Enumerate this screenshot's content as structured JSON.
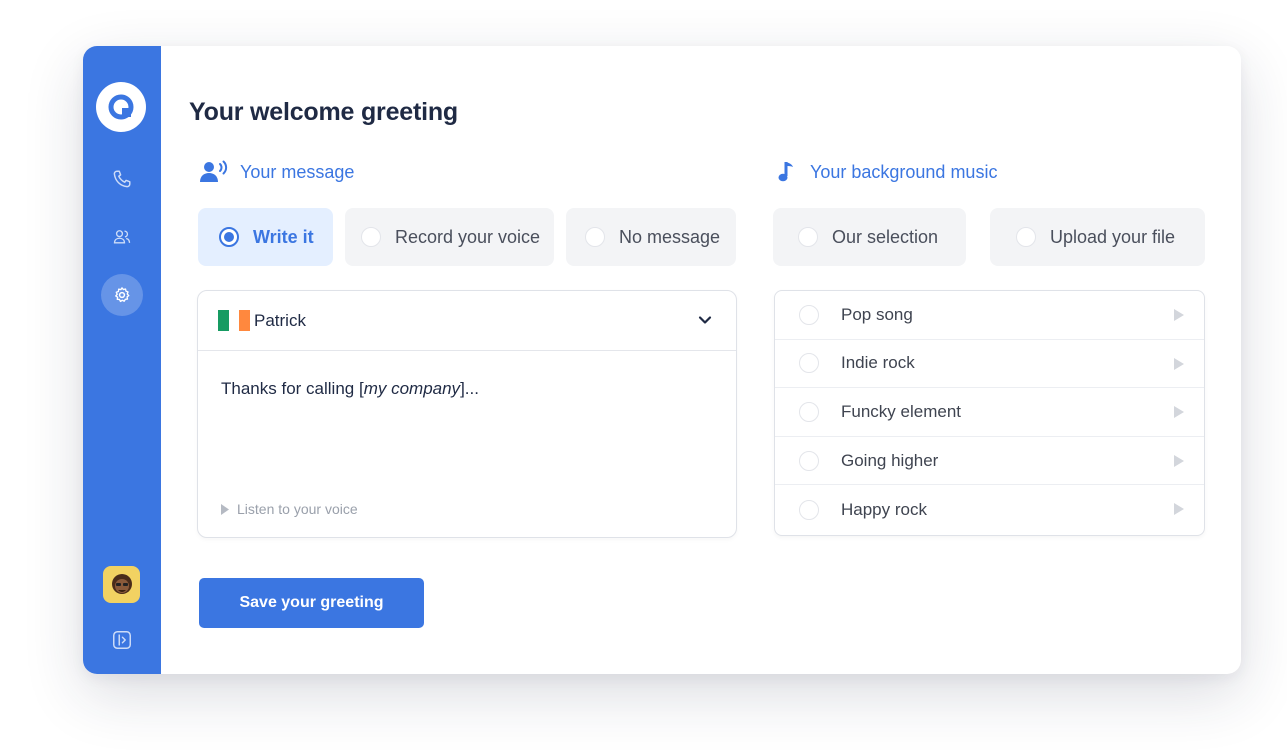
{
  "page": {
    "title": "Your welcome greeting"
  },
  "message_section": {
    "title": "Your message",
    "options": [
      {
        "label": "Write it",
        "selected": true
      },
      {
        "label": "Record your voice",
        "selected": false
      },
      {
        "label": "No message",
        "selected": false
      }
    ],
    "voice": {
      "name": "Patrick",
      "flag_colors": [
        "#169b62",
        "#ffffff",
        "#ff883e"
      ]
    },
    "text_before": "Thanks for calling [",
    "text_italic": "my company",
    "text_after": "]...",
    "listen_label": "Listen to your voice"
  },
  "music_section": {
    "title": "Your background music",
    "options": [
      {
        "label": "Our selection",
        "selected": false
      },
      {
        "label": "Upload your file",
        "selected": false
      }
    ],
    "tracks": [
      {
        "label": "Pop song"
      },
      {
        "label": "Indie rock"
      },
      {
        "label": "Funcky element"
      },
      {
        "label": "Going higher"
      },
      {
        "label": "Happy rock"
      }
    ]
  },
  "actions": {
    "save_label": "Save your greeting"
  },
  "colors": {
    "accent": "#3b76e1",
    "selected_bg": "#e4efff",
    "option_bg": "#f3f4f6"
  },
  "sidebar": {
    "items": [
      {
        "icon": "phone-icon"
      },
      {
        "icon": "users-icon"
      },
      {
        "icon": "gear-icon",
        "active": true
      }
    ]
  }
}
